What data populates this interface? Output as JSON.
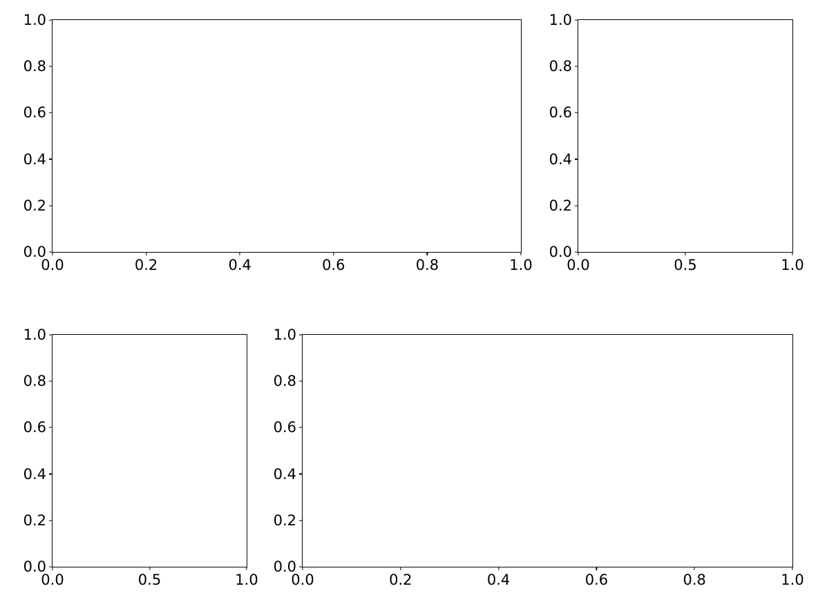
{
  "chart_data": [
    {
      "id": "ax1",
      "type": "bar",
      "values": [],
      "xlim": [
        0.0,
        1.0
      ],
      "ylim": [
        0.0,
        1.0
      ],
      "xticks": [
        0.0,
        0.2,
        0.4,
        0.6,
        0.8,
        1.0
      ],
      "yticks": [
        0.0,
        0.2,
        0.4,
        0.6,
        0.8,
        1.0
      ],
      "xtick_labels": [
        "0.0",
        "0.2",
        "0.4",
        "0.6",
        "0.8",
        "1.0"
      ],
      "ytick_labels": [
        "0.0",
        "0.2",
        "0.4",
        "0.6",
        "0.8",
        "1.0"
      ],
      "xlabel": "",
      "ylabel": "",
      "title": ""
    },
    {
      "id": "ax2",
      "type": "bar",
      "values": [],
      "xlim": [
        0.0,
        1.0
      ],
      "ylim": [
        0.0,
        1.0
      ],
      "xticks": [
        0.0,
        0.5,
        1.0
      ],
      "yticks": [
        0.0,
        0.2,
        0.4,
        0.6,
        0.8,
        1.0
      ],
      "xtick_labels": [
        "0.0",
        "0.5",
        "1.0"
      ],
      "ytick_labels": [
        "0.0",
        "0.2",
        "0.4",
        "0.6",
        "0.8",
        "1.0"
      ],
      "xlabel": "",
      "ylabel": "",
      "title": ""
    },
    {
      "id": "ax3",
      "type": "bar",
      "values": [],
      "xlim": [
        0.0,
        1.0
      ],
      "ylim": [
        0.0,
        1.0
      ],
      "xticks": [
        0.0,
        0.5,
        1.0
      ],
      "yticks": [
        0.0,
        0.2,
        0.4,
        0.6,
        0.8,
        1.0
      ],
      "xtick_labels": [
        "0.0",
        "0.5",
        "1.0"
      ],
      "ytick_labels": [
        "0.0",
        "0.2",
        "0.4",
        "0.6",
        "0.8",
        "1.0"
      ],
      "xlabel": "",
      "ylabel": "",
      "title": ""
    },
    {
      "id": "ax4",
      "type": "bar",
      "values": [],
      "xlim": [
        0.0,
        1.0
      ],
      "ylim": [
        0.0,
        1.0
      ],
      "xticks": [
        0.0,
        0.2,
        0.4,
        0.6,
        0.8,
        1.0
      ],
      "yticks": [
        0.0,
        0.2,
        0.4,
        0.6,
        0.8,
        1.0
      ],
      "xtick_labels": [
        "0.0",
        "0.2",
        "0.4",
        "0.6",
        "0.8",
        "1.0"
      ],
      "ytick_labels": [
        "0.0",
        "0.2",
        "0.4",
        "0.6",
        "0.8",
        "1.0"
      ],
      "xlabel": "",
      "ylabel": "",
      "title": ""
    }
  ]
}
